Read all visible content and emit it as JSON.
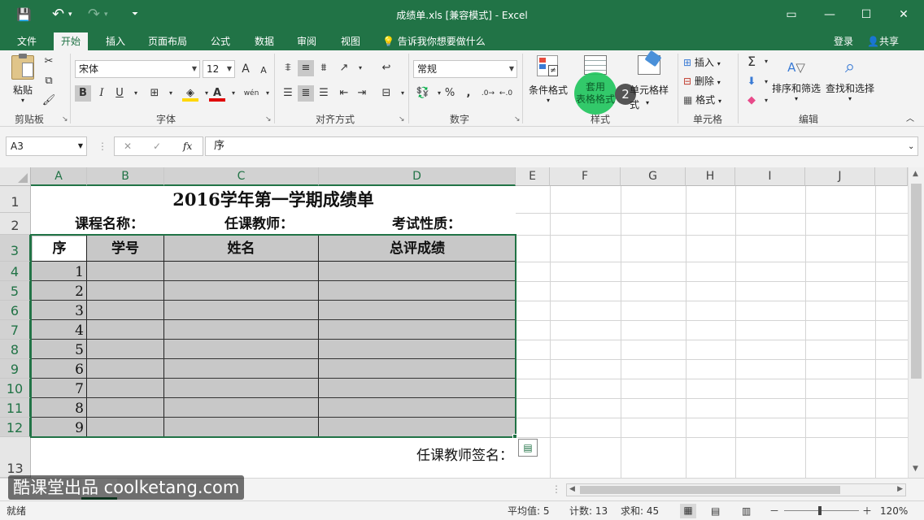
{
  "window": {
    "title": "成绩单.xls  [兼容模式] - Excel",
    "qat_save": "💾",
    "qat_undo": "↶",
    "qat_redo": "↷",
    "qat_more": "⏷",
    "restore_ribbon": "▭",
    "minimize": "—",
    "maximize": "☐",
    "close": "✕"
  },
  "tabs": [
    "文件",
    "开始",
    "插入",
    "页面布局",
    "公式",
    "数据",
    "审阅",
    "视图"
  ],
  "active_tab": "开始",
  "tellme": "告诉我你想要做什么",
  "login": "登录",
  "share": "共享",
  "ribbon": {
    "clipboard": {
      "label": "剪贴板",
      "paste": "粘贴"
    },
    "font": {
      "label": "字体",
      "name": "宋体",
      "size": "12",
      "bold": "B",
      "italic": "I",
      "underline": "U",
      "grow": "A",
      "shrink": "A",
      "wen": "wén"
    },
    "alignment": {
      "label": "对齐方式"
    },
    "number": {
      "label": "数字",
      "format": "常规",
      "percent": "%",
      "comma": ","
    },
    "styles": {
      "label": "样式",
      "conditional": "条件格式",
      "table_format_line1": "套用",
      "table_format_line2": "表格格式",
      "cell_styles": "单元格样式",
      "step_badge": "2"
    },
    "cells": {
      "label": "单元格",
      "insert": "插入",
      "delete": "删除",
      "format": "格式"
    },
    "editing": {
      "label": "编辑",
      "sum": "Σ",
      "sort_filter": "排序和筛选",
      "find_select": "查找和选择"
    }
  },
  "formula_bar": {
    "name_box": "A3",
    "cancel": "✕",
    "enter": "✓",
    "fx": "fx",
    "content": "序"
  },
  "columns": [
    "A",
    "B",
    "C",
    "D",
    "E",
    "F",
    "G",
    "H",
    "I",
    "J"
  ],
  "rows": [
    "1",
    "2",
    "3",
    "4",
    "5",
    "6",
    "7",
    "8",
    "9",
    "10",
    "11",
    "12",
    "13"
  ],
  "sheet": {
    "title": "2016学年第一学期成绩单",
    "course_label": "课程名称：",
    "teacher_label": "任课教师：",
    "exam_label": "考试性质：",
    "headers": [
      "序",
      "学号",
      "姓名",
      "总评成绩"
    ],
    "seq": [
      "1",
      "2",
      "3",
      "4",
      "5",
      "6",
      "7",
      "8",
      "9"
    ],
    "signature": "任课教师签名："
  },
  "status": {
    "ready": "就绪",
    "average": "平均值: 5",
    "count": "计数: 13",
    "sum": "求和: 45",
    "zoom": "120%",
    "zoom_minus": "－",
    "zoom_plus": "＋"
  },
  "watermark": "酷课堂出品 coolketang.com",
  "colors": {
    "excel_green": "#217346",
    "highlight_green": "#22c55e",
    "selection_gray": "#c8c8c8"
  }
}
